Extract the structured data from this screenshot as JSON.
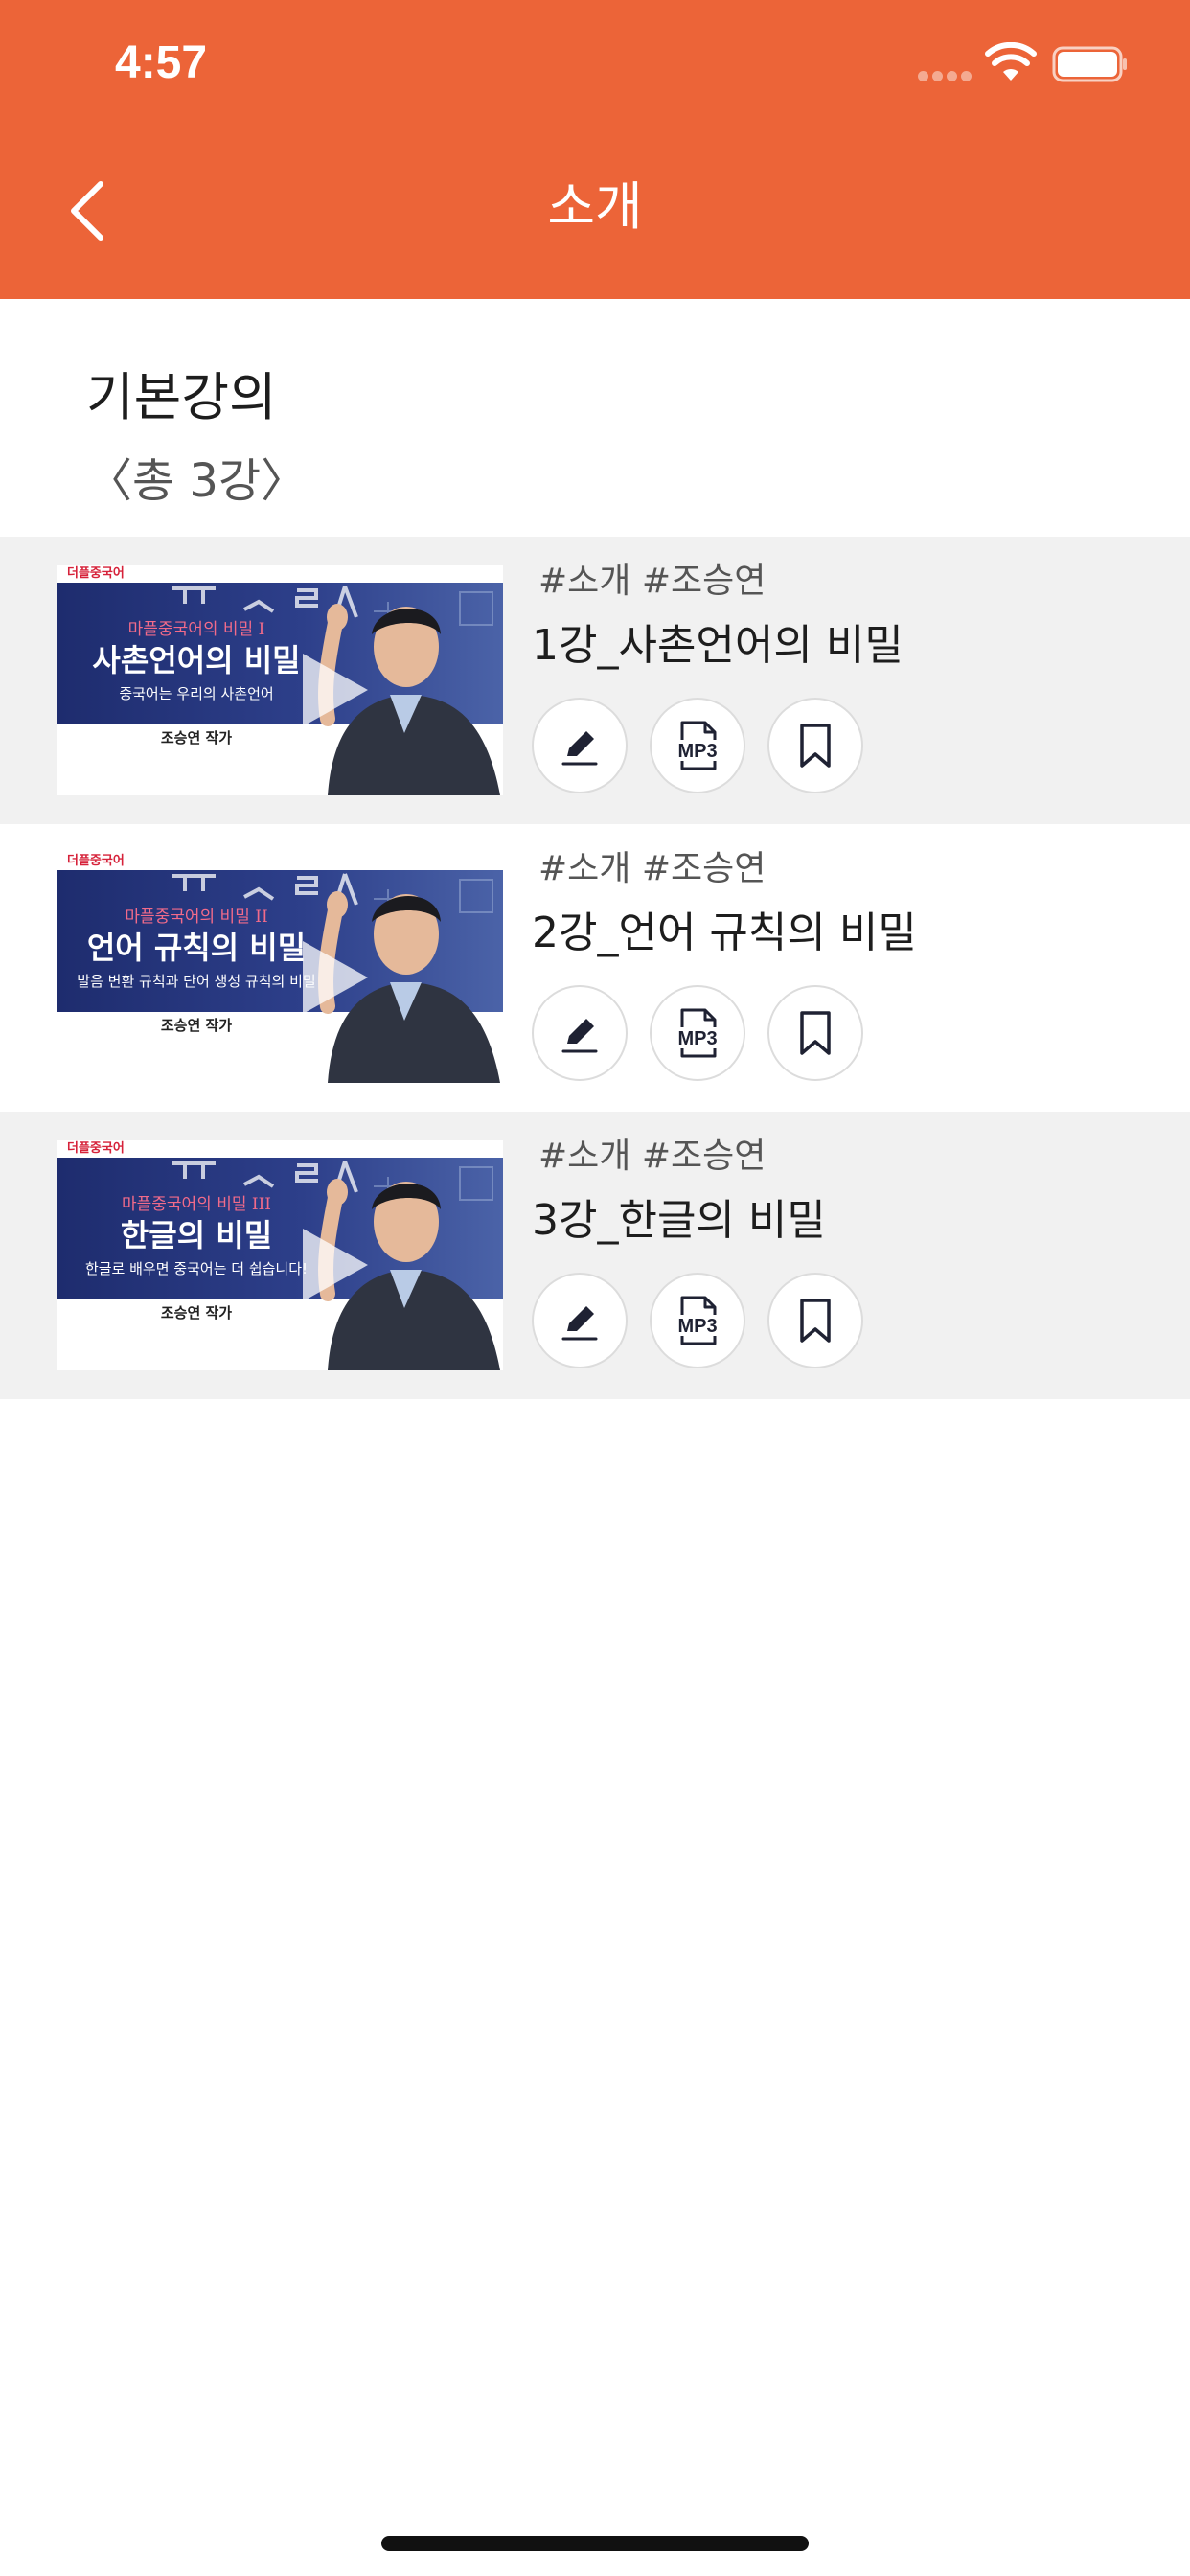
{
  "status_bar": {
    "time": "4:57",
    "icons": [
      "signal-dots-icon",
      "wifi-icon",
      "battery-icon"
    ]
  },
  "nav": {
    "back_icon": "chevron-left-icon",
    "title": "소개"
  },
  "course": {
    "title": "기본강의",
    "count": "〈총 3강〉"
  },
  "lectures": [
    {
      "tags": "#소개 #조승연",
      "title": "1강_사촌언어의 비밀",
      "thumb": {
        "brand": "더플중국어",
        "series": "마플중국어의 비밀 I",
        "headline": "사촌언어의 비밀",
        "subline": "중국어는 우리의 사촌언어",
        "author": "조승연 작가"
      },
      "actions": [
        {
          "label": "",
          "icon": "pencil-icon"
        },
        {
          "label": "MP3",
          "icon": "mp3-file-icon"
        },
        {
          "label": "",
          "icon": "bookmark-icon"
        }
      ]
    },
    {
      "tags": "#소개 #조승연",
      "title": "2강_언어 규칙의 비밀",
      "thumb": {
        "brand": "더플중국어",
        "series": "마플중국어의 비밀 II",
        "headline": "언어 규칙의 비밀",
        "subline": "발음 변환 규칙과 단어 생성 규칙의 비밀",
        "author": "조승연 작가"
      },
      "actions": [
        {
          "label": "",
          "icon": "pencil-icon"
        },
        {
          "label": "MP3",
          "icon": "mp3-file-icon"
        },
        {
          "label": "",
          "icon": "bookmark-icon"
        }
      ]
    },
    {
      "tags": "#소개 #조승연",
      "title": "3강_한글의 비밀",
      "thumb": {
        "brand": "더플중국어",
        "series": "마플중국어의 비밀 III",
        "headline": "한글의 비밀",
        "subline": "한글로 배우면 중국어는 더 쉽습니다!",
        "author": "조승연 작가"
      },
      "actions": [
        {
          "label": "",
          "icon": "pencil-icon"
        },
        {
          "label": "MP3",
          "icon": "mp3-file-icon"
        },
        {
          "label": "",
          "icon": "bookmark-icon"
        }
      ]
    }
  ],
  "colors": {
    "header": "#EC6438",
    "row_shade": "#F1F1F1",
    "icon_dark": "#1f2233"
  }
}
